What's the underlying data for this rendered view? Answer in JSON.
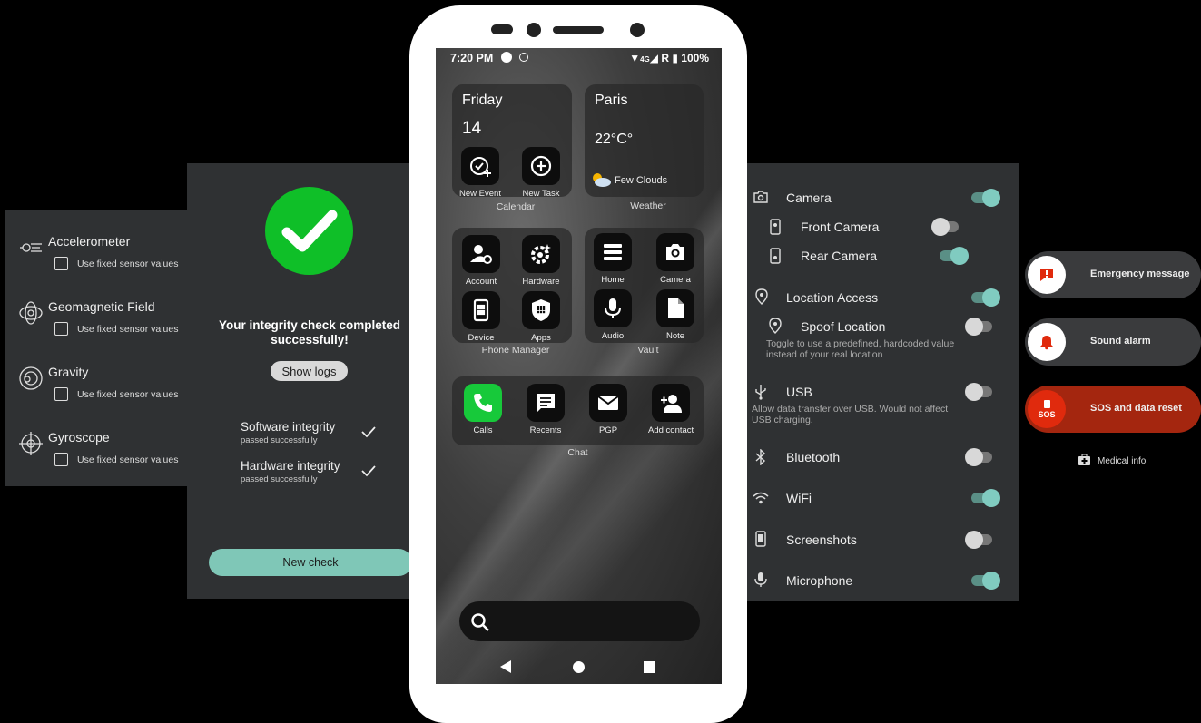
{
  "sensors": {
    "items": [
      {
        "name": "Accelerometer",
        "icon": "accelerometer-icon",
        "check_label": "Use fixed sensor values"
      },
      {
        "name": "Geomagnetic Field",
        "icon": "magnetic-field-icon",
        "check_label": "Use fixed sensor values"
      },
      {
        "name": "Gravity",
        "icon": "gravity-icon",
        "check_label": "Use fixed sensor values"
      },
      {
        "name": "Gyroscope",
        "icon": "gyroscope-icon",
        "check_label": "Use fixed sensor values"
      }
    ]
  },
  "integrity": {
    "title": "Your integrity check completed successfully!",
    "show_logs": "Show logs",
    "rows": [
      {
        "title": "Software integrity",
        "sub": "passed successfully"
      },
      {
        "title": "Hardware integrity",
        "sub": "passed successfully"
      }
    ],
    "new_check": "New check",
    "accent": "#0fbf28"
  },
  "phone": {
    "status": {
      "time": "7:20 PM",
      "network": "4G",
      "roaming": "R",
      "battery": "100%"
    },
    "calendar": {
      "day": "Friday",
      "date": "14",
      "label": "Calendar",
      "apps": [
        {
          "label": "New Event",
          "icon": "event-check-icon"
        },
        {
          "label": "New Task",
          "icon": "add-circle-icon"
        }
      ]
    },
    "weather": {
      "city": "Paris",
      "temp": "22°C°",
      "condition": "Few Clouds",
      "label": "Weather",
      "icon": "partly-cloudy-icon"
    },
    "phone_manager": {
      "label": "Phone Manager",
      "apps": [
        {
          "label": "Account",
          "icon": "account-settings-icon"
        },
        {
          "label": "Hardware",
          "icon": "hardware-gear-icon"
        },
        {
          "label": "Device",
          "icon": "device-icon"
        },
        {
          "label": "Apps",
          "icon": "apps-shield-icon"
        }
      ]
    },
    "vault": {
      "label": "Vault",
      "apps": [
        {
          "label": "Home",
          "icon": "list-icon"
        },
        {
          "label": "Camera",
          "icon": "camera-icon"
        },
        {
          "label": "Audio",
          "icon": "microphone-icon"
        },
        {
          "label": "Note",
          "icon": "note-icon"
        }
      ]
    },
    "chat": {
      "label": "Chat",
      "apps": [
        {
          "label": "Calls",
          "icon": "phone-icon"
        },
        {
          "label": "Recents",
          "icon": "recents-chat-icon"
        },
        {
          "label": "PGP",
          "icon": "mail-icon"
        },
        {
          "label": "Add contact",
          "icon": "add-contact-icon"
        }
      ]
    }
  },
  "permissions": {
    "camera": {
      "label": "Camera",
      "on": true
    },
    "front_camera": {
      "label": "Front Camera",
      "on": false
    },
    "rear_camera": {
      "label": "Rear Camera",
      "on": true
    },
    "location": {
      "label": "Location Access",
      "on": true
    },
    "spoof_location": {
      "label": "Spoof Location",
      "on": false,
      "desc1": "Toggle to use a predefined, hardcoded value",
      "desc2": "instead of your real location"
    },
    "usb": {
      "label": "USB",
      "on": false,
      "desc1": "Allow data transfer over USB. Would not affect",
      "desc2": "USB charging."
    },
    "bluetooth": {
      "label": "Bluetooth",
      "on": false
    },
    "wifi": {
      "label": "WiFi",
      "on": true
    },
    "screenshots": {
      "label": "Screenshots",
      "on": false
    },
    "microphone": {
      "label": "Microphone",
      "on": true
    }
  },
  "emergency": {
    "message": "Emergency message",
    "alarm": "Sound alarm",
    "sos_badge": "SOS",
    "sos": "SOS and data reset",
    "medical": "Medical info",
    "colors": {
      "pill": "#3a3b3d",
      "sos": "#a4260f",
      "icon": "#e02a0d"
    }
  }
}
